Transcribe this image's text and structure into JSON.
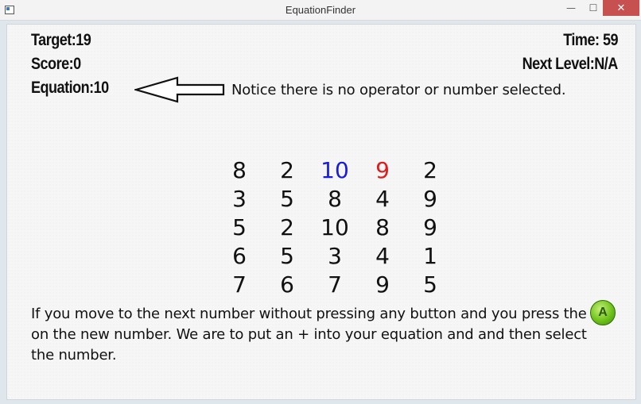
{
  "window": {
    "title": "EquationFinder",
    "minimize": "—",
    "maximize": "☐",
    "close": "✕"
  },
  "stats": {
    "target": "Target:19",
    "score": "Score:0",
    "equation": "Equation:10",
    "time": "Time:  59",
    "next_level": "Next Level:N/A"
  },
  "notice": "Notice there is no operator or number selected.",
  "grid": [
    [
      {
        "v": "8",
        "c": "#111"
      },
      {
        "v": "2",
        "c": "#111"
      },
      {
        "v": "10",
        "c": "#1a1adc"
      },
      {
        "v": "9",
        "c": "#e01b1b"
      },
      {
        "v": "2",
        "c": "#111"
      }
    ],
    [
      {
        "v": "3",
        "c": "#111"
      },
      {
        "v": "5",
        "c": "#111"
      },
      {
        "v": "8",
        "c": "#111"
      },
      {
        "v": "4",
        "c": "#111"
      },
      {
        "v": "9",
        "c": "#111"
      }
    ],
    [
      {
        "v": "5",
        "c": "#111"
      },
      {
        "v": "2",
        "c": "#111"
      },
      {
        "v": "10",
        "c": "#111"
      },
      {
        "v": "8",
        "c": "#111"
      },
      {
        "v": "9",
        "c": "#111"
      }
    ],
    [
      {
        "v": "6",
        "c": "#111"
      },
      {
        "v": "5",
        "c": "#111"
      },
      {
        "v": "3",
        "c": "#111"
      },
      {
        "v": "4",
        "c": "#111"
      },
      {
        "v": "1",
        "c": "#111"
      }
    ],
    [
      {
        "v": "7",
        "c": "#111"
      },
      {
        "v": "6",
        "c": "#111"
      },
      {
        "v": "7",
        "c": "#111"
      },
      {
        "v": "9",
        "c": "#111"
      },
      {
        "v": "5",
        "c": "#111"
      }
    ]
  ],
  "description": "If you move to the next number without pressing any button and you press the on the new number.  We are to put an + into your equation and and then select the number.",
  "a_button_label": "A"
}
